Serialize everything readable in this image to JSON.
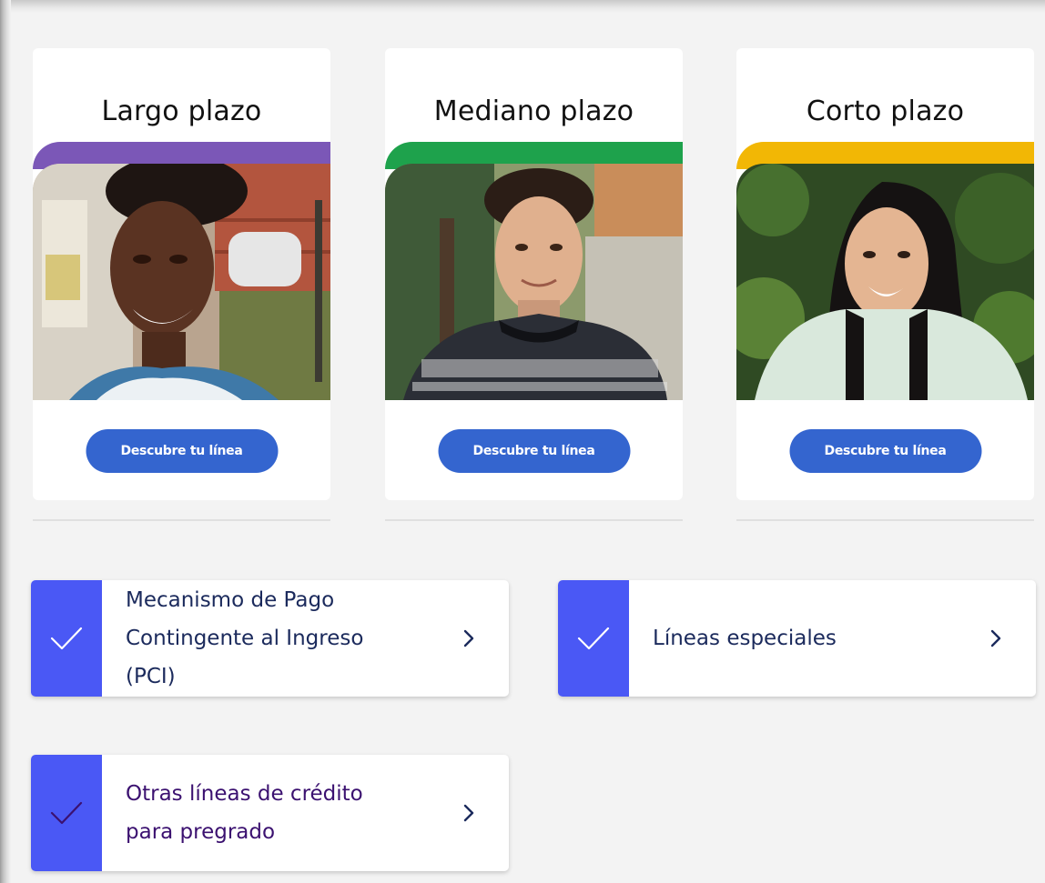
{
  "plans": [
    {
      "title": "Largo plazo",
      "button": "Descubre tu línea",
      "accent": "#7b57b7"
    },
    {
      "title": "Mediano plazo",
      "button": "Descubre tu línea",
      "accent": "#1ea24c"
    },
    {
      "title": "Corto plazo",
      "button": "Descubre tu línea",
      "accent": "#f2b705"
    }
  ],
  "options": [
    {
      "label": "Mecanismo de Pago Contingente al Ingreso (PCI)",
      "color": "#1b2a5c"
    },
    {
      "label": "Líneas especiales",
      "color": "#1b2a5c"
    },
    {
      "label": "Otras líneas de crédito para pregrado",
      "color": "#3b1170"
    }
  ],
  "icons": {
    "check": "check-icon",
    "chevron": "chevron-right-icon"
  },
  "colors": {
    "check_panel": "#4a58f5",
    "button": "#3465cf",
    "background": "#f3f3f3"
  }
}
